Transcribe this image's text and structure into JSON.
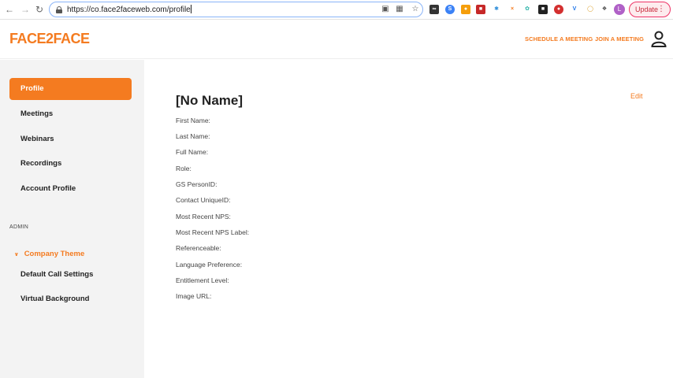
{
  "browser": {
    "url": "https://co.face2faceweb.com/profile",
    "account_initial": "L",
    "update_label": "Update"
  },
  "header": {
    "brand": "FACE2FACE",
    "schedule_label": "SCHEDULE A MEETING",
    "join_label": "JOIN A MEETING"
  },
  "sidebar": {
    "items": [
      {
        "label": "Profile",
        "active": true
      },
      {
        "label": "Meetings"
      },
      {
        "label": "Webinars"
      },
      {
        "label": "Recordings"
      },
      {
        "label": "Account Profile"
      }
    ],
    "admin_label": "ADMIN",
    "admin_group": "Company Theme",
    "admin_items": [
      {
        "label": "Default Call Settings"
      },
      {
        "label": "Virtual Background"
      }
    ]
  },
  "profile": {
    "name": "[No Name]",
    "edit_label": "Edit",
    "fields": [
      "First Name:",
      "Last Name:",
      "Full Name:",
      "Role:",
      "GS PersonID:",
      "Contact UniqueID:",
      "Most Recent NPS:",
      "Most Recent NPS Label:",
      "Referenceable:",
      "Language Preference:",
      "Entitlement Level:",
      "Image URL:"
    ]
  },
  "colors": {
    "accent": "#f47b20",
    "sidebar_bg": "#f3f3f3"
  }
}
